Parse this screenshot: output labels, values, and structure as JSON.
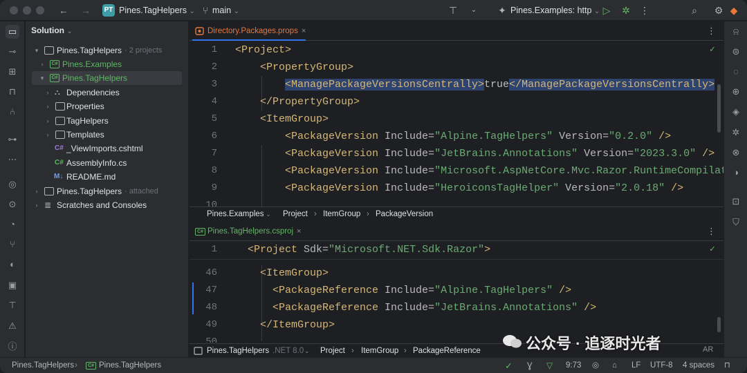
{
  "titlebar": {
    "project_badge": "PT",
    "project_name": "Pines.TagHelpers",
    "branch": "main",
    "run_config": "Pines.Examples: http"
  },
  "project_panel": {
    "header": "Solution",
    "items": [
      {
        "label": "Pines.TagHelpers",
        "extra": "· 2 projects"
      },
      {
        "label": "Pines.Examples",
        "extra": ""
      },
      {
        "label": "Pines.TagHelpers",
        "extra": ""
      },
      {
        "label": "Dependencies",
        "extra": ""
      },
      {
        "label": "Properties",
        "extra": ""
      },
      {
        "label": "TagHelpers",
        "extra": ""
      },
      {
        "label": "Templates",
        "extra": ""
      },
      {
        "label": "_ViewImports.cshtml",
        "extra": ""
      },
      {
        "label": "AssemblyInfo.cs",
        "extra": ""
      },
      {
        "label": "README.md",
        "extra": ""
      },
      {
        "label": "Pines.TagHelpers",
        "extra": "· attached"
      },
      {
        "label": "Scratches and Consoles",
        "extra": ""
      }
    ],
    "icon_labels": {
      "cs": "C#",
      "md": "M↓"
    }
  },
  "editor_top": {
    "tab": "Directory.Packages.props",
    "line_numbers": [
      "1",
      "2",
      "3",
      "4",
      "5",
      "6",
      "7",
      "8",
      "9",
      "10"
    ],
    "lines": {
      "l1": {
        "tag": "<Project>"
      },
      "l2": {
        "tag": "<PropertyGroup>"
      },
      "l3": {
        "open": "<ManagePackageVersionsCentrally>",
        "text": "true",
        "close": "</ManagePackageVersionsCentrally>"
      },
      "l4": {
        "tag": "</PropertyGroup>"
      },
      "l5": {
        "tag": "<ItemGroup>"
      },
      "pkg_tag": "<PackageVersion",
      "attr_include": "Include=",
      "attr_version": "Version=",
      "end": "/>",
      "l6": {
        "include": "\"Alpine.TagHelpers\"",
        "version": "\"0.2.0\""
      },
      "l7": {
        "include": "\"JetBrains.Annotations\"",
        "version": "\"2023.3.0\""
      },
      "l8": {
        "include": "\"Microsoft.AspNetCore.Mvc.Razor.RuntimeCompilati"
      },
      "l9": {
        "include": "\"HeroiconsTagHelper\"",
        "version": "\"2.0.18\""
      }
    },
    "breadcrumbs": [
      "Pines.Examples",
      "Project",
      "ItemGroup",
      "PackageVersion"
    ]
  },
  "editor_bottom": {
    "tab": "Pines.TagHelpers.csproj",
    "line_numbers": [
      "1",
      "46",
      "47",
      "48",
      "49",
      "50"
    ],
    "lines": {
      "l1_tag": "<Project",
      "l1_attr": "Sdk=",
      "l1_val": "\"Microsoft.NET.Sdk.Razor\"",
      "l1_end": ">",
      "l46": "<ItemGroup>",
      "pkg_tag": "<PackageReference",
      "attr_include": "Include=",
      "end": "/>",
      "l47": "\"Alpine.TagHelpers\"",
      "l48": "\"JetBrains.Annotations\"",
      "l49": "</ItemGroup>"
    },
    "breadcrumbs": [
      "Pines.TagHelpers",
      ".NET 8.0",
      "Project",
      "ItemGroup",
      "PackageReference"
    ]
  },
  "statusbar": {
    "path": [
      "Pines.TagHelpers",
      "Pines.TagHelpers"
    ],
    "position": "9:73",
    "line_ending": "LF",
    "encoding": "UTF-8",
    "indent": "4 spaces"
  },
  "watermark": "公众号 · 追逐时光者",
  "watermark_small": "AR",
  "colors": {
    "accent": "#3574f0",
    "tag": "#d5b778",
    "string": "#6aab73",
    "ok": "#5fb865"
  }
}
